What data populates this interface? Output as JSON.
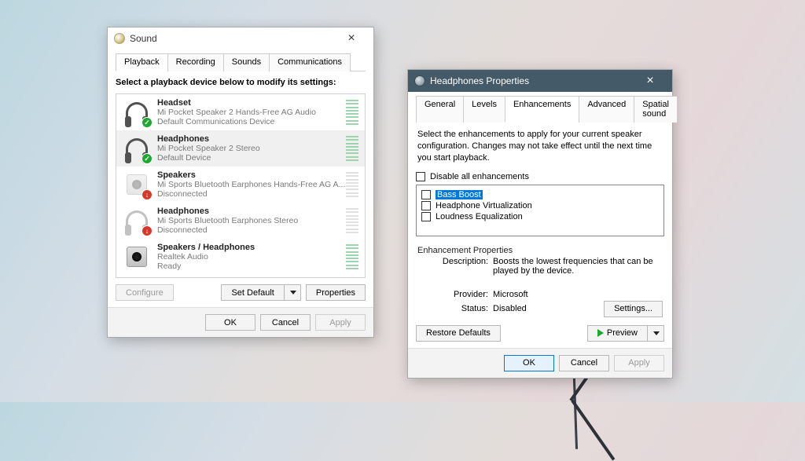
{
  "sound": {
    "title": "Sound",
    "tabs": [
      "Playback",
      "Recording",
      "Sounds",
      "Communications"
    ],
    "activeTab": 0,
    "instruction": "Select a playback device below to modify its settings:",
    "devices": [
      {
        "name": "Headset",
        "sub": "Mi Pocket Speaker 2 Hands-Free AG Audio",
        "status": "Default Communications Device",
        "icon": "headset",
        "badge": "green",
        "disabled": false
      },
      {
        "name": "Headphones",
        "sub": "Mi Pocket Speaker 2 Stereo",
        "status": "Default Device",
        "icon": "headphones",
        "badge": "green",
        "disabled": false
      },
      {
        "name": "Speakers",
        "sub": "Mi Sports Bluetooth Earphones Hands-Free AG A...",
        "status": "Disconnected",
        "icon": "speaker",
        "badge": "red",
        "disabled": true
      },
      {
        "name": "Headphones",
        "sub": "Mi Sports Bluetooth Earphones Stereo",
        "status": "Disconnected",
        "icon": "headphones",
        "badge": "red",
        "disabled": true
      },
      {
        "name": "Speakers / Headphones",
        "sub": "Realtek Audio",
        "status": "Ready",
        "icon": "speaker-dark",
        "badge": "",
        "disabled": false
      }
    ],
    "selectedIndex": 1,
    "configure": "Configure",
    "setDefault": "Set Default",
    "properties": "Properties",
    "ok": "OK",
    "cancel": "Cancel",
    "apply": "Apply"
  },
  "props": {
    "title": "Headphones Properties",
    "tabs": [
      "General",
      "Levels",
      "Enhancements",
      "Advanced",
      "Spatial sound"
    ],
    "activeTab": 2,
    "instruction": "Select the enhancements to apply for your current speaker configuration. Changes may not take effect until the next time you start playback.",
    "disableAll": "Disable all enhancements",
    "enhancements": [
      "Bass Boost",
      "Headphone Virtualization",
      "Loudness Equalization"
    ],
    "selectedEnhancement": 0,
    "fieldset": "Enhancement Properties",
    "descLabel": "Description:",
    "desc": "Boosts the lowest frequencies that can be played by the device.",
    "providerLabel": "Provider:",
    "provider": "Microsoft",
    "statusLabel": "Status:",
    "status": "Disabled",
    "settings": "Settings...",
    "restore": "Restore Defaults",
    "preview": "Preview",
    "ok": "OK",
    "cancel": "Cancel",
    "apply": "Apply"
  }
}
